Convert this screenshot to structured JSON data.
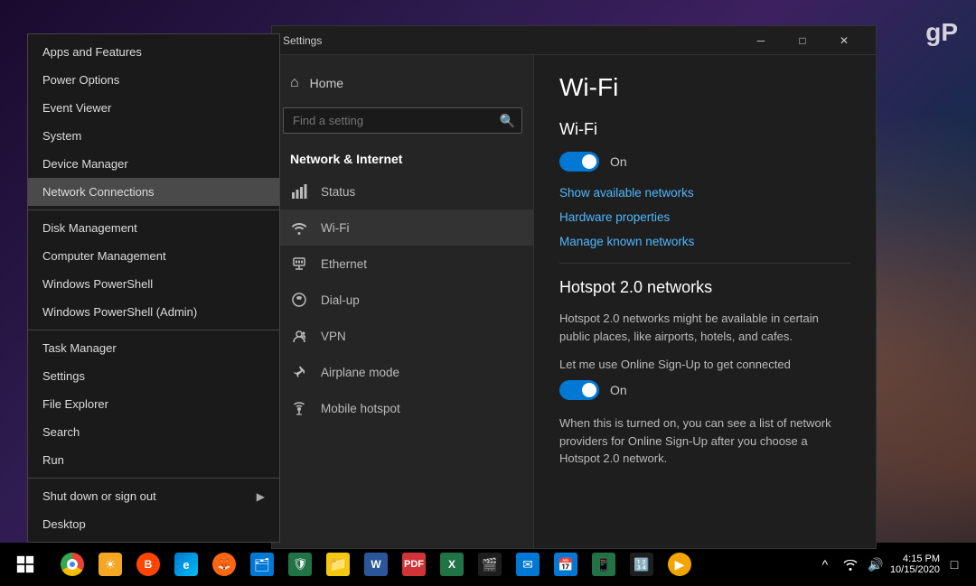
{
  "desktop": {
    "gp_logo": "gP"
  },
  "taskbar": {
    "time": "4:15 PM",
    "date": "10/15/2020"
  },
  "context_menu": {
    "items": [
      {
        "label": "Apps and Features",
        "active": false
      },
      {
        "label": "Power Options",
        "active": false
      },
      {
        "label": "Event Viewer",
        "active": false
      },
      {
        "label": "System",
        "active": false
      },
      {
        "label": "Device Manager",
        "active": false
      },
      {
        "label": "Network Connections",
        "active": true
      }
    ],
    "divider1": true,
    "items2": [
      {
        "label": "Disk Management",
        "active": false
      },
      {
        "label": "Computer Management",
        "active": false
      },
      {
        "label": "Windows PowerShell",
        "active": false
      },
      {
        "label": "Windows PowerShell (Admin)",
        "active": false
      }
    ],
    "divider2": true,
    "items3": [
      {
        "label": "Task Manager",
        "active": false
      },
      {
        "label": "Settings",
        "active": false
      },
      {
        "label": "File Explorer",
        "active": false
      },
      {
        "label": "Search",
        "active": false
      },
      {
        "label": "Run",
        "active": false
      }
    ],
    "divider3": true,
    "items4": [
      {
        "label": "Shut down or sign out",
        "hasArrow": true,
        "active": false
      },
      {
        "label": "Desktop",
        "active": false
      }
    ]
  },
  "settings_window": {
    "title": "Settings",
    "controls": {
      "minimize": "─",
      "maximize": "□",
      "close": "✕"
    },
    "nav": {
      "home_label": "Home",
      "search_placeholder": "Find a setting",
      "section_title": "Network & Internet",
      "items": [
        {
          "id": "status",
          "label": "Status"
        },
        {
          "id": "wifi",
          "label": "Wi-Fi",
          "active": true
        },
        {
          "id": "ethernet",
          "label": "Ethernet"
        },
        {
          "id": "dialup",
          "label": "Dial-up"
        },
        {
          "id": "vpn",
          "label": "VPN"
        },
        {
          "id": "airplane",
          "label": "Airplane mode"
        },
        {
          "id": "hotspot",
          "label": "Mobile hotspot"
        }
      ]
    },
    "content": {
      "page_title": "Wi-Fi",
      "wifi_section": {
        "title": "Wi-Fi",
        "toggle_label": "On",
        "links": [
          "Show available networks",
          "Hardware properties",
          "Manage known networks"
        ]
      },
      "hotspot_section": {
        "title": "Hotspot 2.0 networks",
        "desc": "Hotspot 2.0 networks might be available in certain public places, like airports, hotels, and cafes.",
        "let_me_text": "Let me use Online Sign-Up to get connected",
        "toggle_label": "On",
        "when_text": "When this is turned on, you can see a list of network providers for Online Sign-Up after you choose a Hotspot 2.0 network."
      }
    }
  }
}
